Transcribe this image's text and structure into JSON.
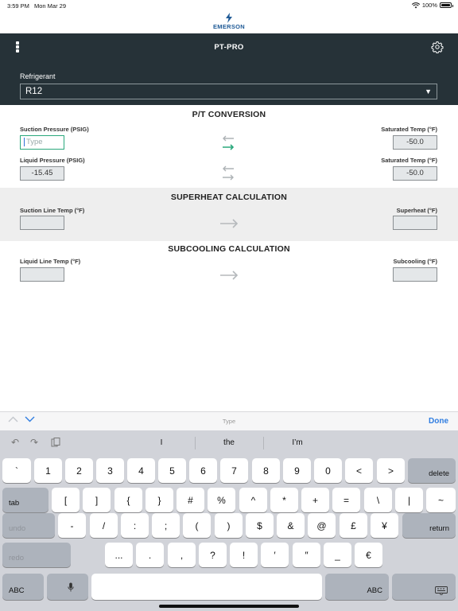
{
  "status_bar": {
    "time": "3:59 PM",
    "date": "Mon Mar 29",
    "battery": "100%"
  },
  "brand": {
    "wordmark": "EMERSON"
  },
  "header": {
    "title": "PT-PRO",
    "refrigerant_label": "Refrigerant",
    "refrigerant_value": "R12"
  },
  "pt_conversion": {
    "title": "P/T CONVERSION",
    "suction_pressure_label": "Suction Pressure (PSIG)",
    "suction_pressure_placeholder": "Type",
    "saturated_temp_label_1": "Saturated Temp (°F)",
    "saturated_temp_value_1": "-50.0",
    "liquid_pressure_label": "Liquid Pressure (PSIG)",
    "liquid_pressure_value": "-15.45",
    "saturated_temp_label_2": "Saturated Temp (°F)",
    "saturated_temp_value_2": "-50.0"
  },
  "superheat": {
    "title": "SUPERHEAT CALCULATION",
    "suction_line_temp_label": "Suction Line Temp (°F)",
    "superheat_label": "Superheat (°F)"
  },
  "subcooling": {
    "title": "SUBCOOLING CALCULATION",
    "liquid_line_temp_label": "Liquid Line Temp (°F)",
    "subcooling_label": "Subcooling (°F)"
  },
  "accessory_bar": {
    "placeholder": "Type",
    "done_label": "Done"
  },
  "keyboard": {
    "suggestions": [
      "I",
      "the",
      "I’m"
    ],
    "row1": [
      "`",
      "1",
      "2",
      "3",
      "4",
      "5",
      "6",
      "7",
      "8",
      "9",
      "0",
      "<",
      ">"
    ],
    "delete_label": "delete",
    "tab_label": "tab",
    "row2": [
      "[",
      "]",
      "{",
      "}",
      "#",
      "%",
      "^",
      "*",
      "+",
      "=",
      "\\",
      "|",
      "~"
    ],
    "undo_label": "undo",
    "row3": [
      "-",
      "/",
      ":",
      ";",
      "(",
      ")",
      "$",
      "&",
      "@",
      "£",
      "¥"
    ],
    "return_label": "return",
    "redo_label": "redo",
    "row4": [
      "...",
      ".",
      ",",
      "?",
      "!",
      "′",
      "″",
      "_",
      "€"
    ],
    "abc_label": "ABC"
  },
  "colors": {
    "header_bg": "#263238",
    "accent_green": "#2aa87c",
    "done_blue": "#2f7de1",
    "brand_blue": "#1f5a96"
  }
}
